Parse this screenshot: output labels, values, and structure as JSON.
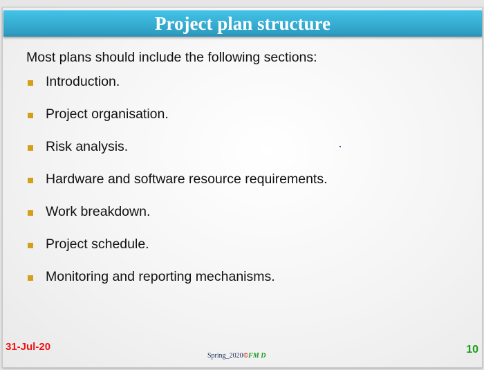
{
  "title": "Project plan structure",
  "intro": "Most plans should include the following sections:",
  "items": [
    "Introduction.",
    "Project organisation.",
    "Risk analysis.",
    "Hardware and software resource requirements.",
    "Work breakdown.",
    "Project schedule.",
    "Monitoring and reporting mechanisms."
  ],
  "footer": {
    "date": "31-Jul-20",
    "term": "Spring_2020",
    "copyright": "©",
    "author": "FM D",
    "page": "10"
  }
}
